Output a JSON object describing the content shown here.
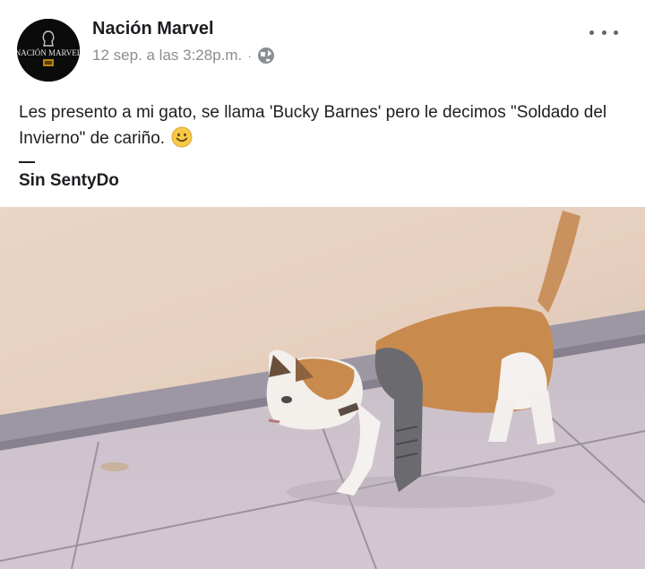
{
  "post": {
    "page_name": "Nación Marvel",
    "timestamp": "12 sep. a las 3:28p.m.",
    "separator": "·",
    "privacy_icon": "globe-icon",
    "menu_icon": "more-options-icon",
    "avatar_text": "NACIÓN MARVEL",
    "body": "Les presento a mi gato, se llama 'Bucky Barnes' pero le decimos \"Soldado del Invierno\" de cariño.",
    "emoji": "smiling-face-emoji",
    "signature_dash": "—",
    "signature": "Sin SentyDo",
    "photo": "cat-walking-photo"
  },
  "colors": {
    "text": "#1c1e21",
    "meta": "#8a8d91",
    "wall": "#e9d2c1",
    "floor": "#cfc3cf",
    "cat_orange": "#c98a4e"
  }
}
